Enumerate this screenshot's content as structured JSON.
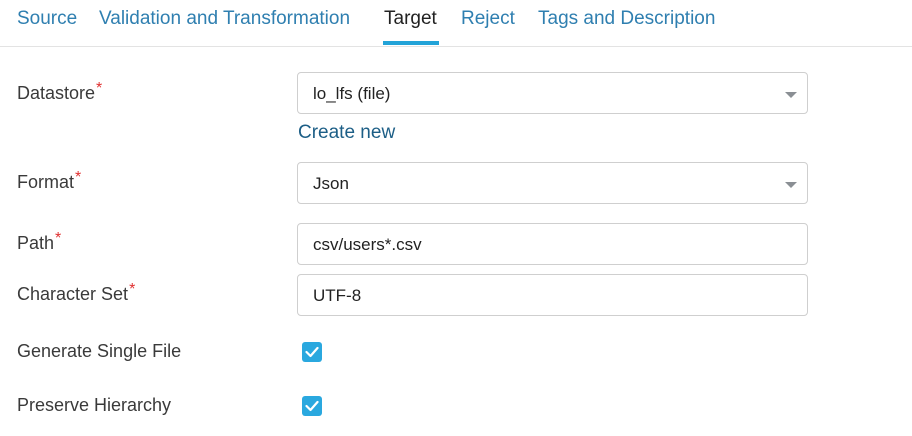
{
  "tabs": [
    {
      "label": "Source",
      "active": false
    },
    {
      "label": "Validation and Transformation",
      "active": false
    },
    {
      "label": "Target",
      "active": true
    },
    {
      "label": "Reject",
      "active": false
    },
    {
      "label": "Tags and Description",
      "active": false
    }
  ],
  "form": {
    "required_marker": "*",
    "datastore": {
      "label": "Datastore",
      "value": "lo_lfs (file)",
      "create_new": "Create new"
    },
    "format": {
      "label": "Format",
      "value": "Json"
    },
    "path": {
      "label": "Path",
      "value": "csv/users*.csv"
    },
    "charset": {
      "label": "Character Set",
      "value": "UTF-8"
    },
    "single_file": {
      "label": "Generate Single File",
      "checked": true
    },
    "preserve_hierarchy": {
      "label": "Preserve Hierarchy",
      "checked": true
    }
  },
  "colors": {
    "accent": "#22a3d8",
    "link": "#2f7fb0",
    "required": "#e03030",
    "checkbox": "#2aa8df"
  },
  "icons": {
    "dropdown": "chevron-down-icon",
    "checkbox": "checkmark-icon"
  }
}
